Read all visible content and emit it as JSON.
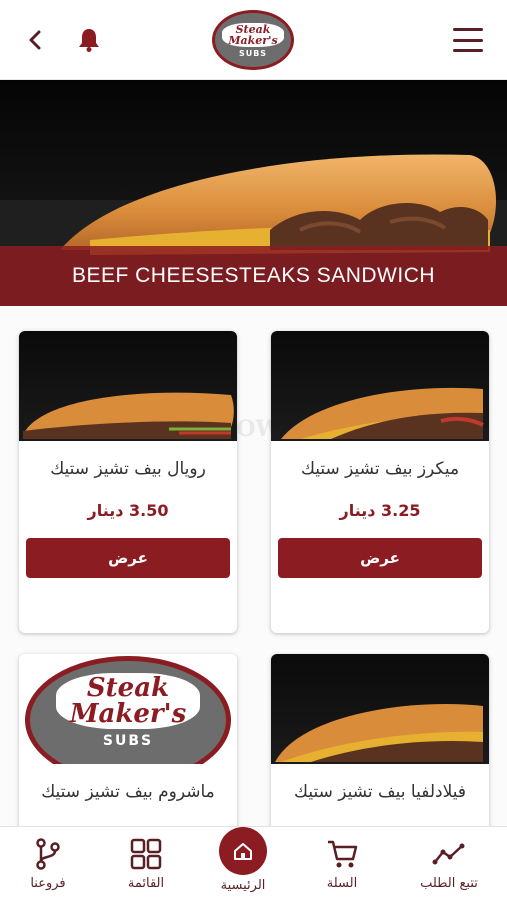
{
  "header": {
    "back_icon": "chevron-left-icon",
    "bell_icon": "bell-icon",
    "menu_icon": "hamburger-menu-icon",
    "logo": {
      "line1": "Steak",
      "line2": "Maker's",
      "sub": "SUBS"
    }
  },
  "hero": {
    "title": "BEEF CHEESESTEAKS SANDWICH"
  },
  "products": [
    {
      "name": "ميكرز بيف تشيز ستيك",
      "price": "3.25 دينار",
      "button": "عرض"
    },
    {
      "name": "رويال بيف تشيز ستيك",
      "price": "3.50 دينار",
      "button": "عرض"
    },
    {
      "name": "فيلادلفيا بيف تشيز ستيك"
    },
    {
      "name": "ماشروم بيف تشيز ستيك",
      "logo": {
        "line1": "Steak",
        "line2": "Maker's",
        "sub": "SUBS"
      }
    }
  ],
  "bottom_nav": {
    "track": {
      "label": "تتبع الطلب",
      "icon": "trend-line-icon"
    },
    "cart": {
      "label": "السلة",
      "icon": "cart-icon"
    },
    "home": {
      "label": "الرئيسية",
      "icon": "home-icon"
    },
    "menu": {
      "label": "القائمة",
      "icon": "grid-icon"
    },
    "branches": {
      "label": "فروعنا",
      "icon": "branch-icon"
    }
  },
  "colors": {
    "brand": "#8b1c22",
    "dark_icon": "#5a1f24",
    "banner": "#8c1c22"
  }
}
